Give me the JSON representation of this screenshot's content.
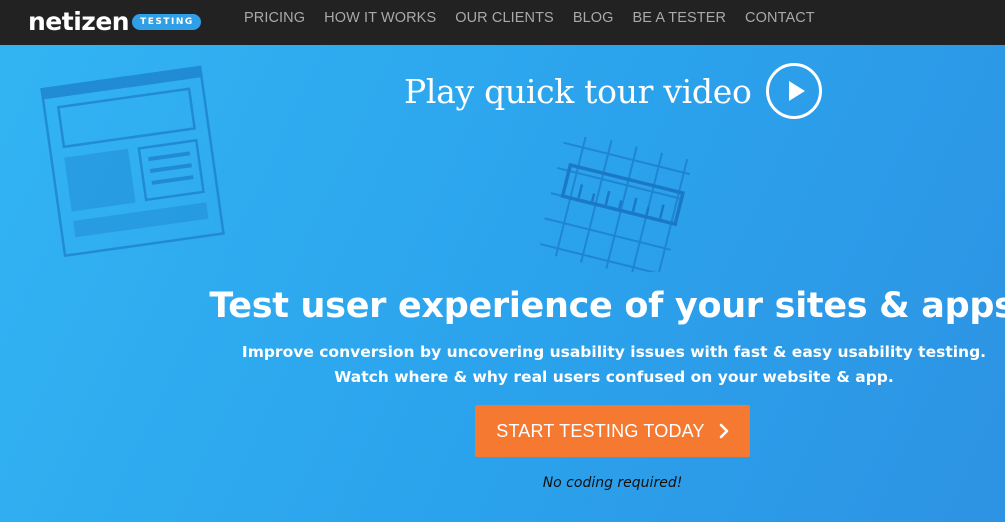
{
  "brand": {
    "logo_text": "netizen",
    "logo_tag": "TESTING"
  },
  "nav": {
    "items": [
      {
        "label": "PRICING"
      },
      {
        "label": "HOW IT WORKS"
      },
      {
        "label": "OUR CLIENTS"
      },
      {
        "label": "BLOG"
      },
      {
        "label": "BE A TESTER"
      },
      {
        "label": "CONTACT"
      }
    ]
  },
  "hero": {
    "tour_label": "Play quick tour video",
    "headline": "Test user experience of your sites & apps",
    "subline_1": "Improve conversion by uncovering usability issues with fast & easy usability testing.",
    "subline_2": "Watch where & why real users confused on your website & app.",
    "cta_label": "START TESTING TODAY",
    "note": "No coding required!"
  },
  "icons": {
    "play": "play-icon",
    "cta_arrow": "chevron-right-icon",
    "decor_1": "wireframe-illustration",
    "decor_2": "ruler-grid-illustration"
  },
  "colors": {
    "navbar": "#222222",
    "hero_blue": "#2ea4ee",
    "cta_orange": "#f57930",
    "nav_text": "#a9a9a9"
  }
}
